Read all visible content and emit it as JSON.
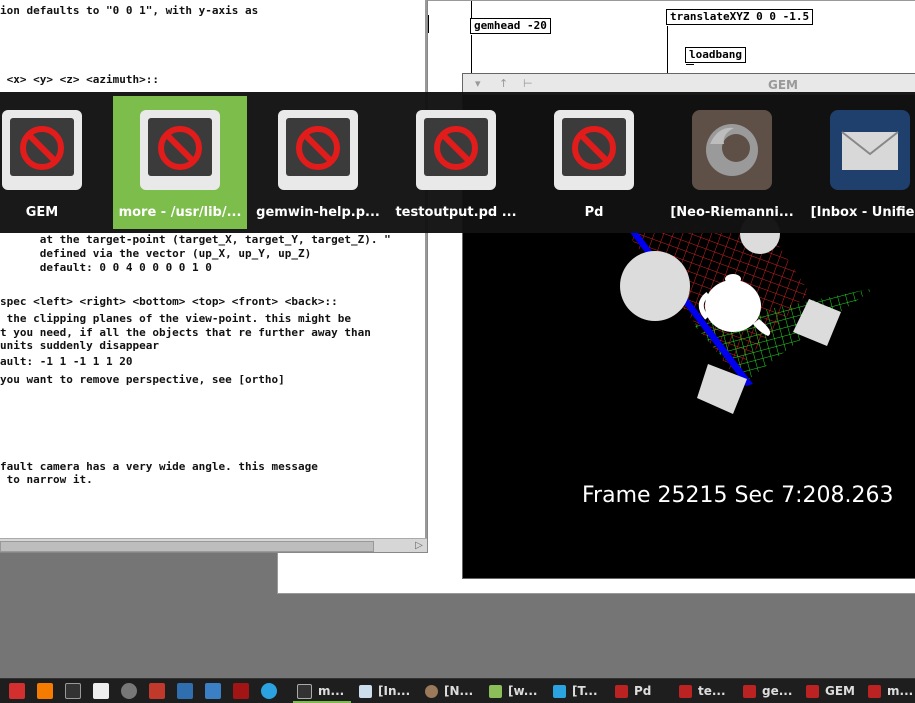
{
  "help_text": {
    "lines": [
      "ion defaults to \"0 0 1\", with y-axis as",
      " <x> <y> <z> <azimuth>::",
      "      at the target-point (target_X, target_Y, target_Z). \"",
      "      defined via the vector (up_X, up_Y, up_Z)",
      "      default: 0 0 4 0 0 0 0 1 0",
      "spec <left> <right> <bottom> <top> <front> <back>::",
      " the clipping planes of the view-point. this might be",
      "t you need, if all the objects that re further away than",
      "units suddenly disappear",
      "ault: -1 1 -1 1 1 20",
      "you want to remove perspective, see [ortho]",
      "fault camera has a very wide angle. this message",
      " to narrow it."
    ]
  },
  "patch": {
    "objects": [
      "gemhead -20",
      "translateXYZ 0 0 -1.5",
      "loadbang"
    ]
  },
  "gem_window": {
    "title": "GEM",
    "frame_counter": "Frame 25215 Sec 7:208.263"
  },
  "switcher": {
    "items": [
      {
        "label": "GEM",
        "icon": "blocked-icon",
        "selected": false
      },
      {
        "label": "more  - /usr/lib/...",
        "icon": "blocked-icon",
        "selected": true
      },
      {
        "label": "gemwin-help.p...",
        "icon": "blocked-icon",
        "selected": false
      },
      {
        "label": "testoutput.pd  ...",
        "icon": "blocked-icon",
        "selected": false
      },
      {
        "label": "Pd",
        "icon": "blocked-icon",
        "selected": false
      },
      {
        "label": "[Neo-Riemanni...",
        "icon": "firefox-icon",
        "selected": false
      },
      {
        "label": "[Inbox - Unifie...",
        "icon": "mail-icon",
        "selected": false
      }
    ]
  },
  "taskbar": {
    "launchers": [
      "media-player-icon",
      "vlc-icon",
      "inkscape-icon",
      "pd-icon",
      "gimp-icon",
      "terminal-icon",
      "screenshot-icon",
      "camera-icon",
      "editor-icon",
      "telegram-icon"
    ],
    "tasks": [
      {
        "label": "m...",
        "icon": "terminal-icon",
        "active": true
      },
      {
        "label": "[In...",
        "icon": "pencil-icon",
        "active": false
      },
      {
        "label": "[N...",
        "icon": "firefox-icon",
        "active": false
      },
      {
        "label": "[w...",
        "icon": "folder-icon",
        "active": false
      },
      {
        "label": "[T...",
        "icon": "telegram-icon",
        "active": false
      },
      {
        "label": "Pd",
        "icon": "pd-icon",
        "active": false
      },
      {
        "label": "te...",
        "icon": "pd-icon",
        "active": false
      },
      {
        "label": "ge...",
        "icon": "pd-icon",
        "active": false
      },
      {
        "label": "GEM",
        "icon": "pd-icon",
        "active": false
      },
      {
        "label": "m...",
        "icon": "pd-icon",
        "active": false
      }
    ]
  },
  "colors": {
    "selection_green": "#7dbd4c",
    "switcher_bg": "#121212",
    "taskbar_bg": "#1e1e1e",
    "desktop_bg": "#757575"
  }
}
